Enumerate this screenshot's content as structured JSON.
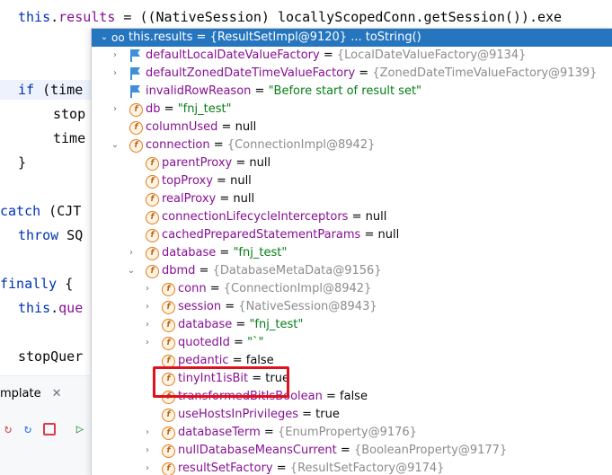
{
  "editor": {
    "lines": [
      {
        "id": "l0",
        "segments": [
          {
            "t": "this",
            "c": "kw"
          },
          {
            "t": ".",
            "c": ""
          },
          {
            "t": "results",
            "c": "fld"
          },
          {
            "t": " = ((NativeSession) locallyScopedConn.getSession()).exe",
            "c": ""
          }
        ]
      },
      {
        "id": "l1",
        "segments": [
          {
            "t": "if",
            "c": "kw"
          },
          {
            "t": " (time",
            "c": ""
          }
        ]
      },
      {
        "id": "l2",
        "segments": [
          {
            "t": "stop",
            "c": ""
          }
        ]
      },
      {
        "id": "l3",
        "segments": [
          {
            "t": "time",
            "c": ""
          }
        ]
      },
      {
        "id": "l4",
        "segments": [
          {
            "t": "}",
            "c": ""
          }
        ]
      },
      {
        "id": "l5",
        "segments": [
          {
            "t": "catch",
            "c": "kw"
          },
          {
            "t": " (CJT",
            "c": ""
          }
        ]
      },
      {
        "id": "l6",
        "segments": [
          {
            "t": "throw",
            "c": "kw"
          },
          {
            "t": " SQ",
            "c": ""
          }
        ]
      },
      {
        "id": "l7",
        "segments": [
          {
            "t": "finally",
            "c": "kw"
          },
          {
            "t": " {",
            "c": ""
          }
        ]
      },
      {
        "id": "l8",
        "segments": [
          {
            "t": "this",
            "c": "kw"
          },
          {
            "t": ".",
            "c": ""
          },
          {
            "t": "que",
            "c": "fld"
          }
        ]
      },
      {
        "id": "l9",
        "segments": [
          {
            "t": "stopQuer",
            "c": ""
          }
        ]
      }
    ]
  },
  "run_panel": {
    "tab_label": "mplate",
    "close_glyph": "✕"
  },
  "popup": {
    "root": {
      "name": "this.results",
      "eq": " = ",
      "ref": "{ResultSetImpl@9120}",
      "extra": " ... toString()"
    },
    "rows": [
      {
        "id": "r1",
        "arrow": "›",
        "icon": "flag",
        "name": "defaultLocalDateValueFactory",
        "ref": "{LocalDateValueFactory@9134}"
      },
      {
        "id": "r2",
        "arrow": "›",
        "icon": "flag",
        "name": "defaultZonedDateTimeValueFactory",
        "ref": "{ZonedDateTimeValueFactory@9139}"
      },
      {
        "id": "r3",
        "arrow": "",
        "icon": "flag",
        "name": "invalidRowReason",
        "str": "\"Before start of result set\""
      },
      {
        "id": "r4",
        "arrow": "›",
        "icon": "f",
        "name": "db",
        "str": "\"fnj_test\""
      },
      {
        "id": "r5",
        "arrow": "",
        "icon": "f",
        "name": "columnUsed",
        "val": "null"
      },
      {
        "id": "r6",
        "arrow": "⌄",
        "icon": "f",
        "name": "connection",
        "ref": "{ConnectionImpl@8942}"
      },
      {
        "id": "r7",
        "arrow": "",
        "icon": "f",
        "name": "parentProxy",
        "val": "null"
      },
      {
        "id": "r8",
        "arrow": "",
        "icon": "f",
        "name": "topProxy",
        "val": "null"
      },
      {
        "id": "r9",
        "arrow": "",
        "icon": "f",
        "name": "realProxy",
        "val": "null"
      },
      {
        "id": "r10",
        "arrow": "",
        "icon": "f",
        "name": "connectionLifecycleInterceptors",
        "val": "null"
      },
      {
        "id": "r11",
        "arrow": "",
        "icon": "f",
        "name": "cachedPreparedStatementParams",
        "val": "null"
      },
      {
        "id": "r12",
        "arrow": "›",
        "icon": "f",
        "name": "database",
        "str": "\"fnj_test\""
      },
      {
        "id": "r13",
        "arrow": "⌄",
        "icon": "f",
        "name": "dbmd",
        "ref": "{DatabaseMetaData@9156}"
      },
      {
        "id": "r14",
        "arrow": "›",
        "icon": "f",
        "name": "conn",
        "ref": "{ConnectionImpl@8942}"
      },
      {
        "id": "r15",
        "arrow": "›",
        "icon": "f",
        "name": "session",
        "ref": "{NativeSession@8943}"
      },
      {
        "id": "r16",
        "arrow": "›",
        "icon": "f",
        "name": "database",
        "str": "\"fnj_test\""
      },
      {
        "id": "r17",
        "arrow": "›",
        "icon": "f",
        "name": "quotedId",
        "str": "\"`\""
      },
      {
        "id": "r18",
        "arrow": "",
        "icon": "f",
        "name": "pedantic",
        "val": "false"
      },
      {
        "id": "r19",
        "arrow": "",
        "icon": "f",
        "name": "tinyInt1isBit",
        "val": "true"
      },
      {
        "id": "r20",
        "arrow": "",
        "icon": "f",
        "name": "transformedBitIsBoolean",
        "val": "false"
      },
      {
        "id": "r21",
        "arrow": "",
        "icon": "f",
        "name": "useHostsInPrivileges",
        "val": "true"
      },
      {
        "id": "r22",
        "arrow": "›",
        "icon": "f",
        "name": "databaseTerm",
        "ref": "{EnumProperty@9176}"
      },
      {
        "id": "r23",
        "arrow": "›",
        "icon": "f",
        "name": "nullDatabaseMeansCurrent",
        "ref": "{BooleanProperty@9177}"
      },
      {
        "id": "r24",
        "arrow": "›",
        "icon": "f",
        "name": "resultSetFactory",
        "ref": "{ResultSetFactory@9174}"
      }
    ]
  },
  "colors": {
    "selection": "#2675bf",
    "highlight_box": "#e0101c",
    "field_name": "#871094",
    "string_value": "#067d17",
    "reference": "#8c8c8c"
  }
}
